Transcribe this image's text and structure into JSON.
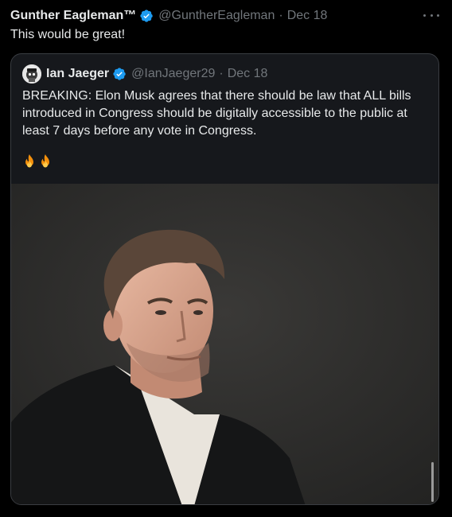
{
  "tweet": {
    "author_name": "Gunther Eagleman™",
    "handle": "@GuntherEagleman",
    "separator": "·",
    "date": "Dec 18",
    "text": "This would be great!",
    "more_icon": "more-horizontal-icon",
    "verified_icon": "verified-badge-icon"
  },
  "quote": {
    "author_name": "Ian Jaeger",
    "handle": "@IanJaeger29",
    "separator": "·",
    "date": "Dec 18",
    "text": "BREAKING: Elon Musk agrees that there should be law that ALL bills introduced in Congress should be digitally accessible to the public at least 7 days before any vote in Congress.",
    "emojis": [
      "fire-icon",
      "fire-icon"
    ],
    "image": "photo of a man in a dark suit jacket and white shirt against a dark background"
  },
  "colors": {
    "background": "#000000",
    "text_primary": "#e7e9ea",
    "text_secondary": "#71767b",
    "verified": "#1d9bf0",
    "border": "#3a3d42"
  }
}
